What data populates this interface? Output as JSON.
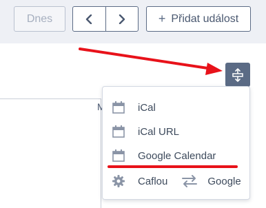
{
  "toolbar": {
    "today_label": "Dnes",
    "add_event_label": "Přidat událost"
  },
  "colors": {
    "accent": "#5b6b85",
    "annotation": "#e8121a",
    "topbar_bg": "#eef0f5"
  },
  "calendar": {
    "partial_header_letter": "M"
  },
  "export_menu": {
    "items": [
      {
        "label": "iCal",
        "icon": "calendar-icon"
      },
      {
        "label": "iCal URL",
        "icon": "calendar-icon"
      },
      {
        "label": "Google Calendar",
        "icon": "calendar-icon"
      }
    ],
    "sync": {
      "icon": "gear-icon",
      "left_label": "Caflou",
      "swap_icon": "swap-arrows-icon",
      "right_label": "Google"
    }
  }
}
